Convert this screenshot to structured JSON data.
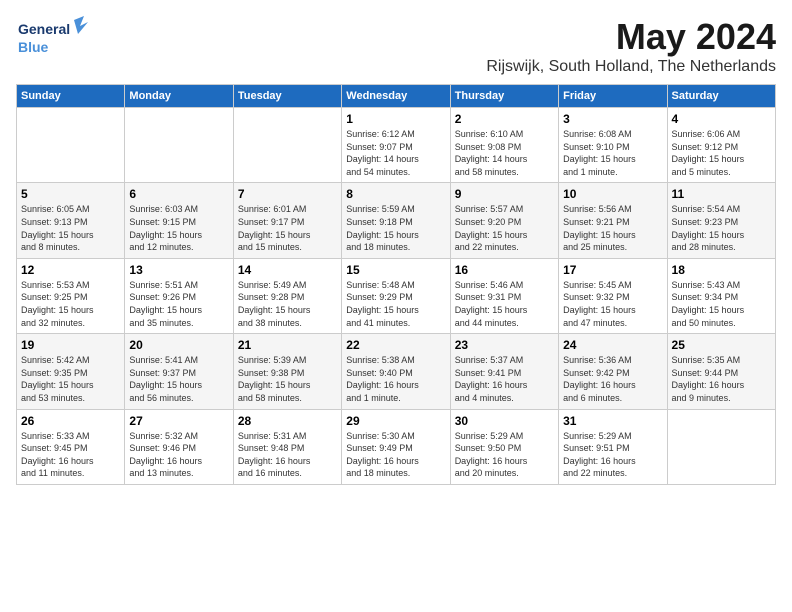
{
  "header": {
    "logo_general": "General",
    "logo_blue": "Blue",
    "month_year": "May 2024",
    "location": "Rijswijk, South Holland, The Netherlands"
  },
  "weekdays": [
    "Sunday",
    "Monday",
    "Tuesday",
    "Wednesday",
    "Thursday",
    "Friday",
    "Saturday"
  ],
  "weeks": [
    [
      {
        "day": "",
        "info": ""
      },
      {
        "day": "",
        "info": ""
      },
      {
        "day": "",
        "info": ""
      },
      {
        "day": "1",
        "info": "Sunrise: 6:12 AM\nSunset: 9:07 PM\nDaylight: 14 hours\nand 54 minutes."
      },
      {
        "day": "2",
        "info": "Sunrise: 6:10 AM\nSunset: 9:08 PM\nDaylight: 14 hours\nand 58 minutes."
      },
      {
        "day": "3",
        "info": "Sunrise: 6:08 AM\nSunset: 9:10 PM\nDaylight: 15 hours\nand 1 minute."
      },
      {
        "day": "4",
        "info": "Sunrise: 6:06 AM\nSunset: 9:12 PM\nDaylight: 15 hours\nand 5 minutes."
      }
    ],
    [
      {
        "day": "5",
        "info": "Sunrise: 6:05 AM\nSunset: 9:13 PM\nDaylight: 15 hours\nand 8 minutes."
      },
      {
        "day": "6",
        "info": "Sunrise: 6:03 AM\nSunset: 9:15 PM\nDaylight: 15 hours\nand 12 minutes."
      },
      {
        "day": "7",
        "info": "Sunrise: 6:01 AM\nSunset: 9:17 PM\nDaylight: 15 hours\nand 15 minutes."
      },
      {
        "day": "8",
        "info": "Sunrise: 5:59 AM\nSunset: 9:18 PM\nDaylight: 15 hours\nand 18 minutes."
      },
      {
        "day": "9",
        "info": "Sunrise: 5:57 AM\nSunset: 9:20 PM\nDaylight: 15 hours\nand 22 minutes."
      },
      {
        "day": "10",
        "info": "Sunrise: 5:56 AM\nSunset: 9:21 PM\nDaylight: 15 hours\nand 25 minutes."
      },
      {
        "day": "11",
        "info": "Sunrise: 5:54 AM\nSunset: 9:23 PM\nDaylight: 15 hours\nand 28 minutes."
      }
    ],
    [
      {
        "day": "12",
        "info": "Sunrise: 5:53 AM\nSunset: 9:25 PM\nDaylight: 15 hours\nand 32 minutes."
      },
      {
        "day": "13",
        "info": "Sunrise: 5:51 AM\nSunset: 9:26 PM\nDaylight: 15 hours\nand 35 minutes."
      },
      {
        "day": "14",
        "info": "Sunrise: 5:49 AM\nSunset: 9:28 PM\nDaylight: 15 hours\nand 38 minutes."
      },
      {
        "day": "15",
        "info": "Sunrise: 5:48 AM\nSunset: 9:29 PM\nDaylight: 15 hours\nand 41 minutes."
      },
      {
        "day": "16",
        "info": "Sunrise: 5:46 AM\nSunset: 9:31 PM\nDaylight: 15 hours\nand 44 minutes."
      },
      {
        "day": "17",
        "info": "Sunrise: 5:45 AM\nSunset: 9:32 PM\nDaylight: 15 hours\nand 47 minutes."
      },
      {
        "day": "18",
        "info": "Sunrise: 5:43 AM\nSunset: 9:34 PM\nDaylight: 15 hours\nand 50 minutes."
      }
    ],
    [
      {
        "day": "19",
        "info": "Sunrise: 5:42 AM\nSunset: 9:35 PM\nDaylight: 15 hours\nand 53 minutes."
      },
      {
        "day": "20",
        "info": "Sunrise: 5:41 AM\nSunset: 9:37 PM\nDaylight: 15 hours\nand 56 minutes."
      },
      {
        "day": "21",
        "info": "Sunrise: 5:39 AM\nSunset: 9:38 PM\nDaylight: 15 hours\nand 58 minutes."
      },
      {
        "day": "22",
        "info": "Sunrise: 5:38 AM\nSunset: 9:40 PM\nDaylight: 16 hours\nand 1 minute."
      },
      {
        "day": "23",
        "info": "Sunrise: 5:37 AM\nSunset: 9:41 PM\nDaylight: 16 hours\nand 4 minutes."
      },
      {
        "day": "24",
        "info": "Sunrise: 5:36 AM\nSunset: 9:42 PM\nDaylight: 16 hours\nand 6 minutes."
      },
      {
        "day": "25",
        "info": "Sunrise: 5:35 AM\nSunset: 9:44 PM\nDaylight: 16 hours\nand 9 minutes."
      }
    ],
    [
      {
        "day": "26",
        "info": "Sunrise: 5:33 AM\nSunset: 9:45 PM\nDaylight: 16 hours\nand 11 minutes."
      },
      {
        "day": "27",
        "info": "Sunrise: 5:32 AM\nSunset: 9:46 PM\nDaylight: 16 hours\nand 13 minutes."
      },
      {
        "day": "28",
        "info": "Sunrise: 5:31 AM\nSunset: 9:48 PM\nDaylight: 16 hours\nand 16 minutes."
      },
      {
        "day": "29",
        "info": "Sunrise: 5:30 AM\nSunset: 9:49 PM\nDaylight: 16 hours\nand 18 minutes."
      },
      {
        "day": "30",
        "info": "Sunrise: 5:29 AM\nSunset: 9:50 PM\nDaylight: 16 hours\nand 20 minutes."
      },
      {
        "day": "31",
        "info": "Sunrise: 5:29 AM\nSunset: 9:51 PM\nDaylight: 16 hours\nand 22 minutes."
      },
      {
        "day": "",
        "info": ""
      }
    ]
  ]
}
